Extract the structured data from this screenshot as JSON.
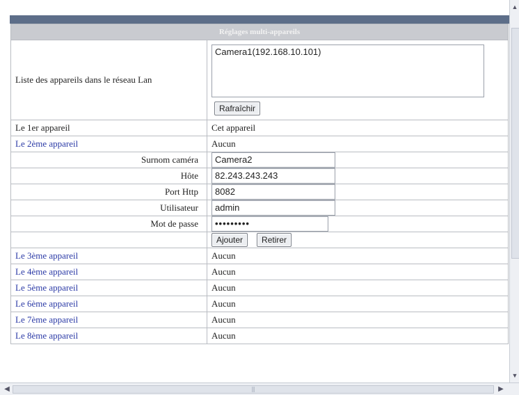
{
  "panel": {
    "title": "Réglages multi-appareils"
  },
  "lan": {
    "label": "Liste des appareils dans le réseau Lan",
    "items": [
      "Camera1(192.168.10.101)"
    ],
    "refresh_label": "Rafraîchir"
  },
  "device1": {
    "label": "Le 1er appareil",
    "value": "Cet appareil"
  },
  "device2": {
    "label": "Le 2ème appareil",
    "value": "Aucun"
  },
  "form": {
    "nickname_label": "Surnom caméra",
    "nickname_value": "Camera2",
    "host_label": "Hôte",
    "host_value": "82.243.243.243",
    "port_label": "Port Http",
    "port_value": "8082",
    "user_label": "Utilisateur",
    "user_value": "admin",
    "password_label": "Mot de passe",
    "password_value": "•••••••••",
    "add_label": "Ajouter",
    "remove_label": "Retirer"
  },
  "devices": [
    {
      "label": "Le 3ème appareil",
      "value": "Aucun"
    },
    {
      "label": "Le 4ème appareil",
      "value": "Aucun"
    },
    {
      "label": "Le 5ème appareil",
      "value": "Aucun"
    },
    {
      "label": "Le 6ème appareil",
      "value": "Aucun"
    },
    {
      "label": "Le 7ème appareil",
      "value": "Aucun"
    },
    {
      "label": "Le 8ème appareil",
      "value": "Aucun"
    }
  ],
  "icons": {
    "scroll_up": "scroll-up-arrow-icon",
    "scroll_down": "scroll-down-arrow-icon",
    "scroll_left": "scroll-left-arrow-icon",
    "scroll_right": "scroll-right-arrow-icon"
  },
  "colors": {
    "header_strip": "#5d6e89",
    "title_row": "#c9cbd0",
    "link": "#2b3aa6"
  }
}
